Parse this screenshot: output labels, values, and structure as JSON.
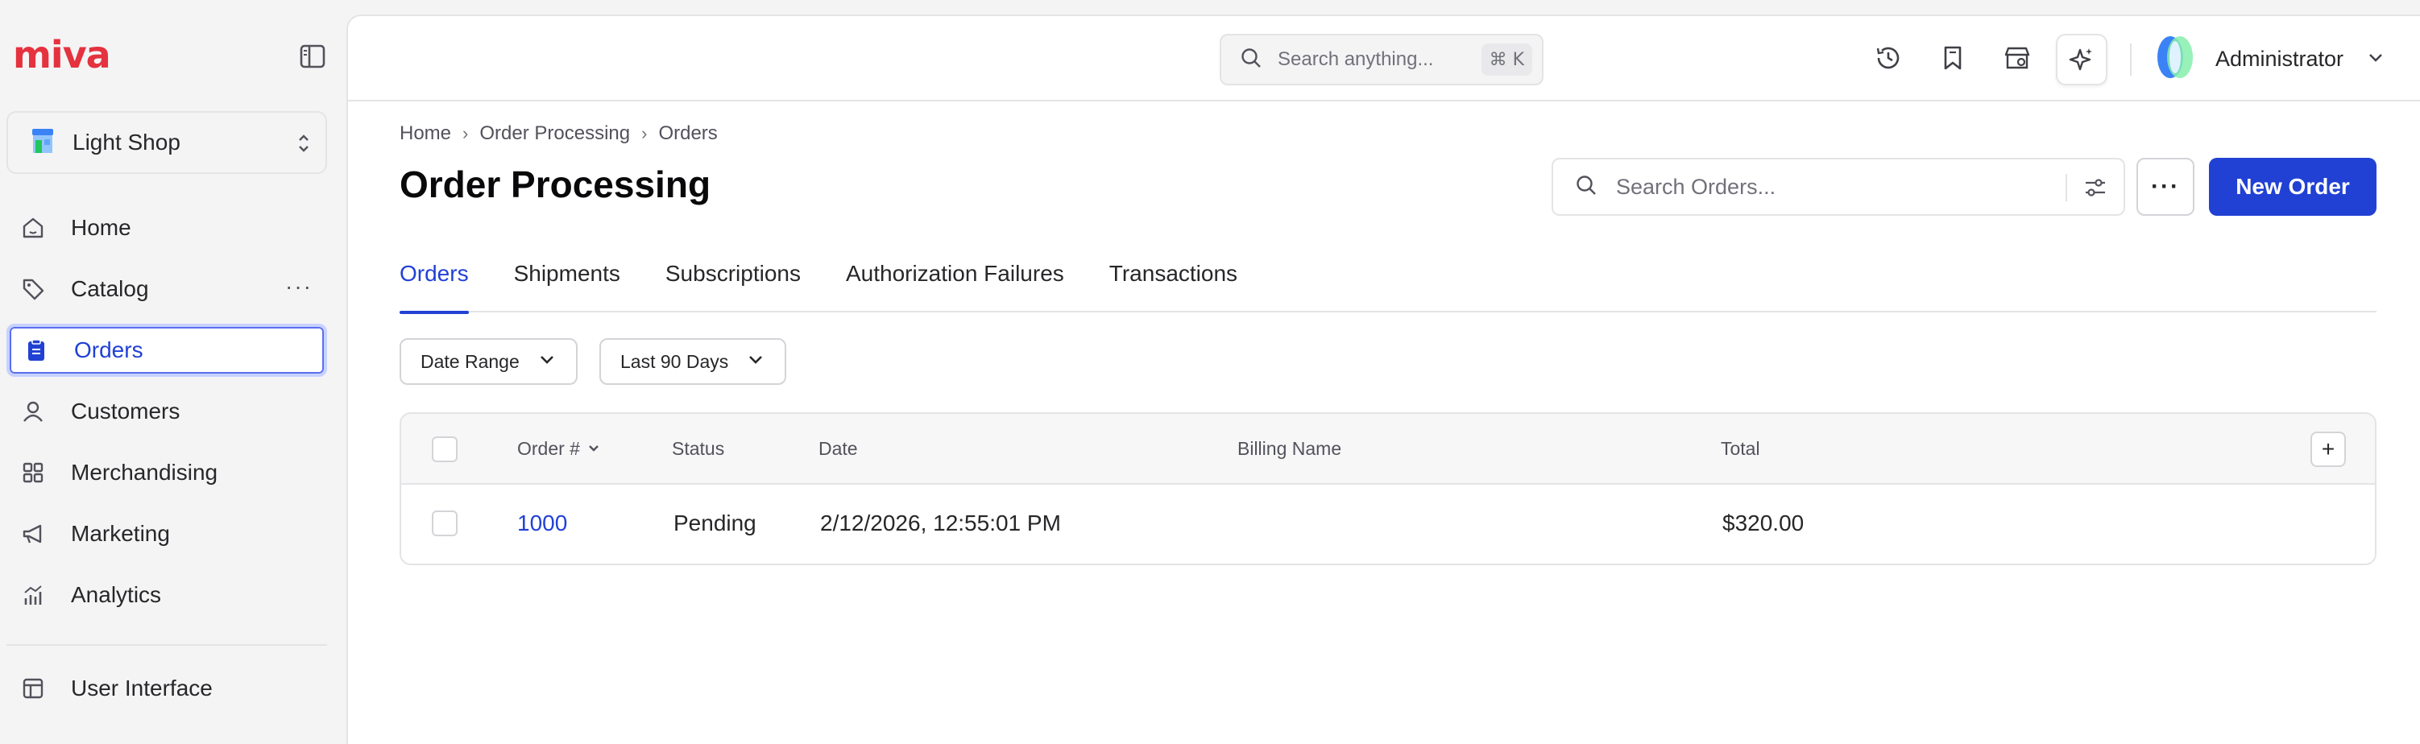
{
  "sidebar": {
    "logo": "miva",
    "store": {
      "name": "Light Shop"
    },
    "items": [
      {
        "label": "Home",
        "icon": "home-icon"
      },
      {
        "label": "Catalog",
        "icon": "tag-icon"
      },
      {
        "label": "Orders",
        "icon": "clipboard-icon",
        "active": true
      },
      {
        "label": "Customers",
        "icon": "user-icon"
      },
      {
        "label": "Merchandising",
        "icon": "grid-icon"
      },
      {
        "label": "Marketing",
        "icon": "megaphone-icon"
      },
      {
        "label": "Analytics",
        "icon": "bar-chart-icon"
      }
    ],
    "more_label": "···",
    "footer_items": [
      {
        "label": "User Interface",
        "icon": "layout-icon"
      }
    ]
  },
  "topbar": {
    "search_placeholder": "Search anything...",
    "shortcut": "⌘ K",
    "user_name": "Administrator"
  },
  "breadcrumb": [
    "Home",
    "Order Processing",
    "Orders"
  ],
  "page": {
    "title": "Order Processing",
    "search_placeholder": "Search Orders...",
    "more_label": "···",
    "new_button": "New Order"
  },
  "tabs": [
    "Orders",
    "Shipments",
    "Subscriptions",
    "Authorization Failures",
    "Transactions"
  ],
  "filters": [
    "Date Range",
    "Last 90 Days"
  ],
  "table": {
    "columns": [
      "Order #",
      "Status",
      "Date",
      "Billing Name",
      "Total"
    ],
    "add_column_label": "+",
    "rows": [
      {
        "order": "1000",
        "status": "Pending",
        "date": "2/12/2026, 12:55:01 PM",
        "billing_name": "",
        "total": "$320.00"
      }
    ]
  },
  "colors": {
    "accent": "#2141d4",
    "brand": "#e5323f"
  }
}
